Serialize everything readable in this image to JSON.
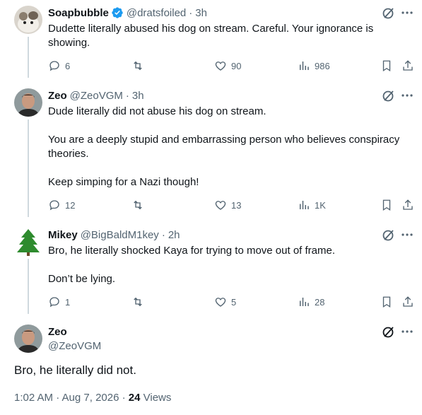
{
  "tweets": [
    {
      "name": "Soapbubble",
      "handle": "@dratsfoiled",
      "dot": "·",
      "time": "3h",
      "verified": true,
      "lines": [
        "Dudette literally abused his dog on stream. Careful. Your ignorance is showing."
      ],
      "replies": "6",
      "reposts": "",
      "likes": "90",
      "views": "986"
    },
    {
      "name": "Zeo",
      "handle": "@ZeoVGM",
      "dot": "·",
      "time": "3h",
      "lines": [
        "Dude literally did not abuse his dog on stream.",
        "You are a deeply stupid and embarrassing person who believes conspiracy theories.",
        "Keep simping for a Nazi though!"
      ],
      "replies": "12",
      "reposts": "",
      "likes": "13",
      "views": "1K"
    },
    {
      "name": "Mikey",
      "handle": "@BigBaldM1key",
      "dot": "·",
      "time": "2h",
      "lines": [
        "Bro, he literally shocked Kaya for trying to move out of frame.",
        "Don’t be lying."
      ],
      "replies": "1",
      "reposts": "",
      "likes": "5",
      "views": "28"
    }
  ],
  "main": {
    "name": "Zeo",
    "handle": "@ZeoVGM",
    "text": "Bro, he literally did not.",
    "timestamp": "1:02 AM · Aug 7, 2026 · ",
    "views_count": "24",
    "views_label": " Views"
  },
  "icons": [
    "verified-badge-icon",
    "grok-icon",
    "more-icon",
    "reply-icon",
    "repost-icon",
    "like-icon",
    "views-icon",
    "bookmark-icon",
    "share-icon"
  ],
  "colors": {
    "text": "#0f1419",
    "secondary": "#536471",
    "verified": "#1d9bf0",
    "line": "#cfd9de"
  }
}
